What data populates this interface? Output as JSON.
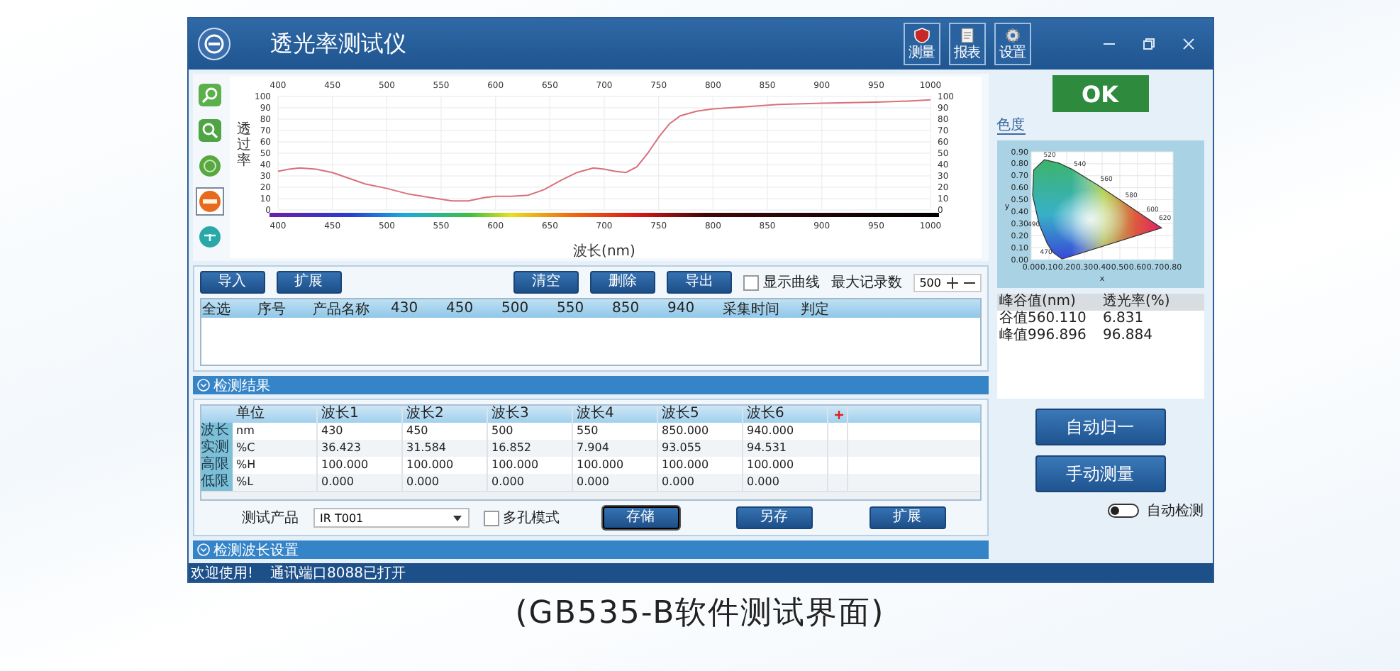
{
  "window": {
    "title": "透光率测试仪",
    "tools": [
      {
        "label": "测量",
        "kind": "shield"
      },
      {
        "label": "报表",
        "kind": "report"
      },
      {
        "label": "设置",
        "kind": "gear"
      }
    ]
  },
  "spectrum_chart": {
    "top_ticks": [
      "400",
      "450",
      "500",
      "550",
      "600",
      "650",
      "700",
      "750",
      "800",
      "850",
      "900",
      "950",
      "1000"
    ],
    "bottom_ticks": [
      "400",
      "450",
      "500",
      "550",
      "600",
      "650",
      "700",
      "750",
      "800",
      "850",
      "900",
      "950",
      "1000"
    ],
    "right_ticks": [
      "100",
      "90",
      "80",
      "70",
      "60",
      "50",
      "40",
      "30",
      "20",
      "10",
      "0"
    ],
    "chart_data": {
      "type": "line",
      "grid": true,
      "xlabel": "波长(nm)",
      "ylabel": "透过率",
      "xlim": [
        400,
        1000
      ],
      "ylim": [
        0,
        100
      ],
      "xticks": [
        400,
        450,
        500,
        550,
        600,
        650,
        700,
        750,
        800,
        850,
        900,
        950,
        1000
      ],
      "yticks": [
        0,
        10,
        20,
        30,
        40,
        50,
        60,
        70,
        80,
        90,
        100
      ],
      "x": [
        400,
        410,
        420,
        435,
        450,
        465,
        480,
        500,
        520,
        540,
        560,
        575,
        590,
        600,
        615,
        630,
        645,
        660,
        675,
        690,
        700,
        710,
        720,
        730,
        740,
        750,
        760,
        770,
        785,
        800,
        830,
        860,
        900,
        950,
        980,
        1000
      ],
      "series": [
        {
          "color": "#d9707a",
          "values": [
            34,
            36,
            37,
            36,
            33,
            28,
            23,
            19,
            14,
            11,
            8,
            8,
            11,
            12,
            12,
            13,
            18,
            26,
            33,
            37,
            36,
            34,
            33,
            38,
            50,
            64,
            76,
            83,
            87,
            89,
            91,
            93,
            94,
            95,
            96,
            97
          ]
        }
      ]
    }
  },
  "records": {
    "buttons_left": [
      "导入",
      "扩展"
    ],
    "buttons_right": [
      "清空",
      "删除",
      "导出"
    ],
    "show_curve": {
      "label": "显示曲线",
      "checked": false
    },
    "max_records": {
      "label": "最大记录数",
      "value": "500"
    },
    "columns": [
      "全选",
      "序号",
      "产品名称",
      "430",
      "450",
      "500",
      "550",
      "850",
      "940",
      "采集时间",
      "判定"
    ]
  },
  "results_section": {
    "title": "检测结果"
  },
  "limits_table": {
    "columns": [
      "单位",
      "波长1",
      "波长2",
      "波长3",
      "波长4",
      "波长5",
      "波长6"
    ],
    "rows": [
      {
        "header": "波长",
        "cells": [
          "nm",
          "430",
          "450",
          "500",
          "550",
          "850.000",
          "940.000"
        ]
      },
      {
        "header": "实测",
        "cells": [
          "%C",
          "36.423",
          "31.584",
          "16.852",
          "7.904",
          "93.055",
          "94.531"
        ]
      },
      {
        "header": "高限",
        "cells": [
          "%H",
          "100.000",
          "100.000",
          "100.000",
          "100.000",
          "100.000",
          "100.000"
        ]
      },
      {
        "header": "低限",
        "cells": [
          "%L",
          "0.000",
          "0.000",
          "0.000",
          "0.000",
          "0.000",
          "0.000"
        ]
      }
    ]
  },
  "product": {
    "label": "测试产品",
    "value": "IR T001"
  },
  "multi_hole": {
    "label": "多孔模式",
    "checked": false
  },
  "actions": [
    {
      "label": "存储",
      "selected": true
    },
    {
      "label": "另存",
      "selected": false
    },
    {
      "label": "扩展",
      "selected": false
    }
  ],
  "wavelength_section": {
    "title": "检测波长设置"
  },
  "status_bar": [
    "欢迎使用!",
    "通讯端口8088已打开"
  ],
  "result": {
    "text": "OK",
    "pass": true
  },
  "chromaticity": {
    "tab": "色度",
    "xlabel": "x",
    "ylabel": "y",
    "xticks": [
      "0.00",
      "0.10",
      "0.20",
      "0.30",
      "0.40",
      "0.50",
      "0.60",
      "0.70",
      "0.80"
    ],
    "yticks": [
      "0.90",
      "0.80",
      "0.70",
      "0.60",
      "0.50",
      "0.40",
      "0.30",
      "0.20",
      "0.10",
      "0.00"
    ],
    "wavelengths": [
      "520",
      "540",
      "560",
      "580",
      "600",
      "620",
      "490",
      "470"
    ]
  },
  "peaks": {
    "columns": [
      "峰谷值(nm)",
      "透光率(%)"
    ],
    "rows": [
      [
        "谷值560.110",
        "6.831"
      ],
      [
        "峰值996.896",
        "96.884"
      ]
    ]
  },
  "buttons": [
    "自动归一",
    "手动测量"
  ],
  "auto_detect": {
    "label": "自动检测",
    "on": false
  },
  "caption": "(GB535-B软件测试界面)"
}
